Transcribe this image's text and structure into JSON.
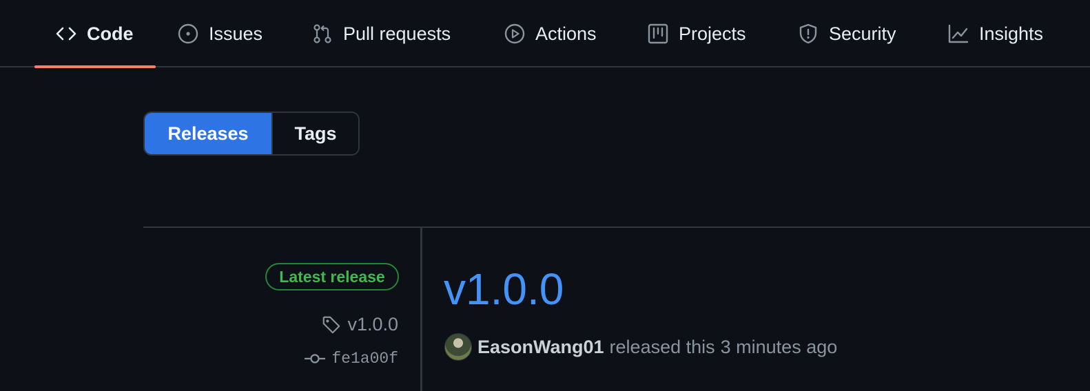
{
  "nav": {
    "tabs": [
      {
        "label": "Code",
        "icon": "code-icon",
        "selected": true
      },
      {
        "label": "Issues",
        "icon": "issue-opened-icon",
        "selected": false
      },
      {
        "label": "Pull requests",
        "icon": "git-pull-request-icon",
        "selected": false
      },
      {
        "label": "Actions",
        "icon": "play-icon",
        "selected": false
      },
      {
        "label": "Projects",
        "icon": "table-icon",
        "selected": false
      },
      {
        "label": "Security",
        "icon": "shield-icon",
        "selected": false
      },
      {
        "label": "Insights",
        "icon": "graph-icon",
        "selected": false
      }
    ],
    "accent_color": "#f78166"
  },
  "toggle": {
    "releases_label": "Releases",
    "tags_label": "Tags",
    "active": "Releases"
  },
  "release": {
    "badge": "Latest release",
    "tag": "v1.0.0",
    "commit": "fe1a00f",
    "title": "v1.0.0",
    "author": "EasonWang01",
    "released_text": "released this",
    "time": "3 minutes ago"
  },
  "colors": {
    "background": "#0d1117",
    "link": "#4493f8",
    "badge_green": "#3fb950",
    "button_blue": "#2f74e4"
  }
}
